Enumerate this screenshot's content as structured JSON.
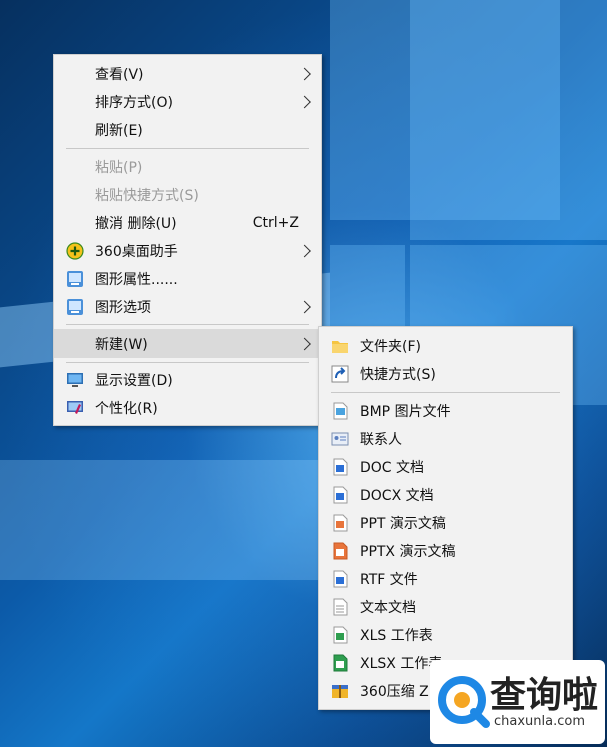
{
  "context_menu": {
    "items": [
      {
        "label": "查看(V)"
      },
      {
        "label": "排序方式(O)"
      },
      {
        "label": "刷新(E)"
      },
      {
        "label": "粘贴(P)"
      },
      {
        "label": "粘贴快捷方式(S)"
      },
      {
        "label": "撤消 删除(U)",
        "shortcut": "Ctrl+Z"
      },
      {
        "label": "360桌面助手",
        "icon": "360-plus-icon"
      },
      {
        "label": "图形属性......",
        "icon": "graphics-icon"
      },
      {
        "label": "图形选项",
        "icon": "graphics-icon"
      },
      {
        "label": "新建(W)"
      },
      {
        "label": "显示设置(D)",
        "icon": "monitor-icon"
      },
      {
        "label": "个性化(R)",
        "icon": "personalize-icon"
      }
    ]
  },
  "new_submenu": {
    "items": [
      {
        "label": "文件夹(F)",
        "icon": "folder-icon"
      },
      {
        "label": "快捷方式(S)",
        "icon": "shortcut-arrow-icon"
      },
      {
        "label": "BMP 图片文件",
        "icon": "bmp-file-icon"
      },
      {
        "label": "联系人",
        "icon": "contact-card-icon"
      },
      {
        "label": "DOC 文档",
        "icon": "doc-file-icon"
      },
      {
        "label": "DOCX 文档",
        "icon": "docx-file-icon"
      },
      {
        "label": "PPT 演示文稿",
        "icon": "ppt-file-icon"
      },
      {
        "label": "PPTX 演示文稿",
        "icon": "pptx-file-icon"
      },
      {
        "label": "RTF 文件",
        "icon": "rtf-file-icon"
      },
      {
        "label": "文本文档",
        "icon": "text-file-icon"
      },
      {
        "label": "XLS 工作表",
        "icon": "xls-file-icon"
      },
      {
        "label": "XLSX 工作表",
        "icon": "xlsx-file-icon"
      },
      {
        "label": "360压缩 Z",
        "icon": "zip-archive-icon"
      }
    ]
  },
  "watermark": {
    "title": "查询啦",
    "domain": "chaxunla.com",
    "accent": "#1e88e5"
  },
  "colors": {
    "menu_bg": "#f2f2f2",
    "hover": "#dadada",
    "disabled": "#9a9a9a",
    "desktop": "#0c5aa8"
  }
}
